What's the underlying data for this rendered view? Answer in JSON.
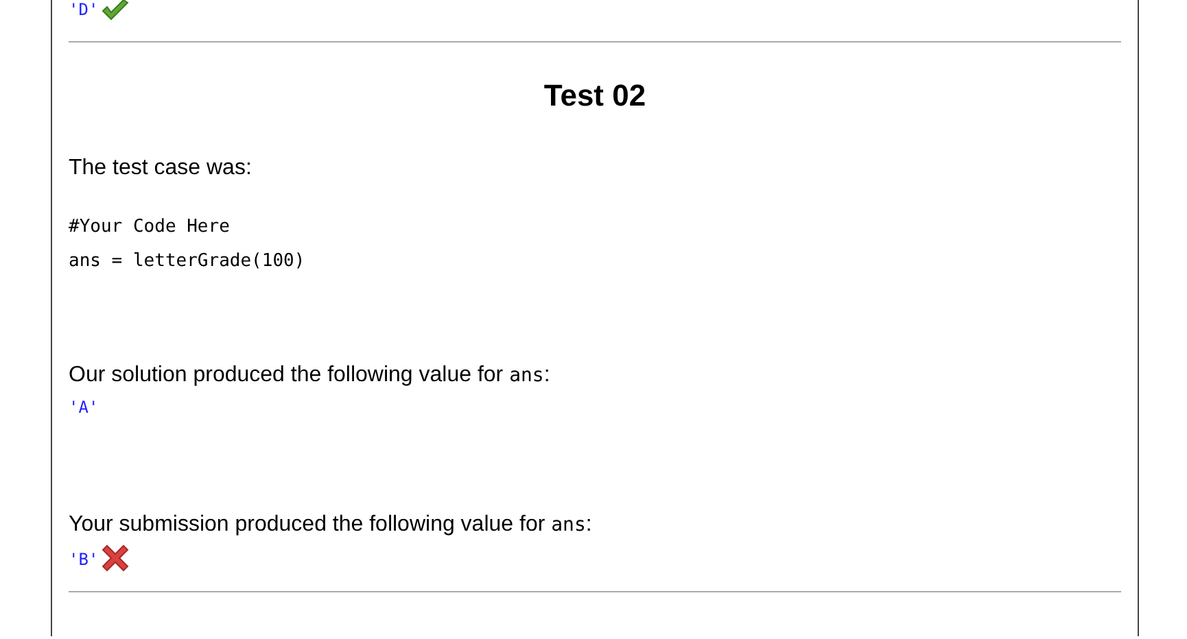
{
  "previous_result": {
    "value": "'D'",
    "correct": true
  },
  "test": {
    "title": "Test 02",
    "intro": "The test case was:",
    "code_lines": [
      "#Your Code Here",
      "ans = letterGrade(100)"
    ],
    "results": [
      {
        "text": "Our solution produced the following value for ",
        "variable": "ans",
        "suffix": ":",
        "value": "'A'"
      },
      {
        "text": "Your submission produced the following value for ",
        "variable": "ans",
        "suffix": ":",
        "value": "'B'",
        "correct": false
      }
    ]
  }
}
